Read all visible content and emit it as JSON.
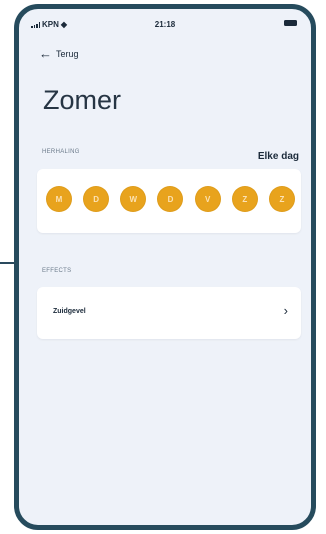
{
  "status_bar": {
    "carrier": "KPN",
    "time": "21:18"
  },
  "nav": {
    "back_label": "Terug"
  },
  "page": {
    "title": "Zomer"
  },
  "repeat": {
    "section_label": "HERHALING",
    "value": "Elke dag",
    "days": [
      "M",
      "D",
      "W",
      "D",
      "V",
      "Z",
      "Z"
    ],
    "day_color": "#e8a31d"
  },
  "effect": {
    "section_label": "EFFECTS",
    "item_label": "Zuidgevel"
  },
  "icons": [
    "signal-icon",
    "wifi-icon",
    "battery-icon",
    "back-arrow-icon",
    "chevron-right-icon"
  ]
}
